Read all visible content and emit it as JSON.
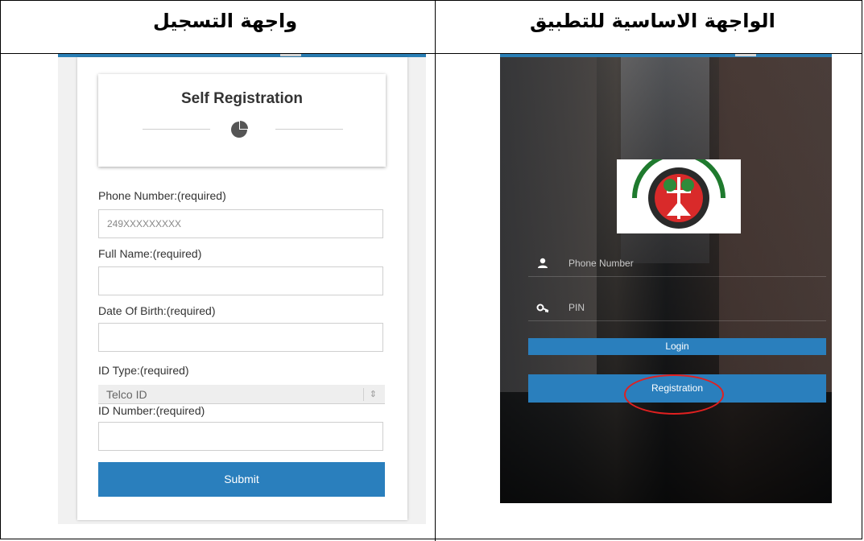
{
  "headers": {
    "left": "واجهة التسجيل",
    "right": "الواجهة الاساسية للتطبيق"
  },
  "registration": {
    "title": "Self Registration",
    "phone_label": "Phone Number:(required)",
    "phone_placeholder": "249XXXXXXXXX",
    "fullname_label": "Full Name:(required)",
    "dob_label": "Date Of Birth:(required)",
    "idtype_label": "ID Type:(required)",
    "idtype_selected": "Telco ID",
    "idnumber_label": "ID Number:(required)",
    "submit_label": "Submit"
  },
  "login_screen": {
    "phone_placeholder": "Phone Number",
    "pin_placeholder": "PIN",
    "login_label": "Login",
    "registration_label": "Registration"
  },
  "colors": {
    "accent": "#2a7fbd",
    "highlight_circle": "#e02020"
  }
}
